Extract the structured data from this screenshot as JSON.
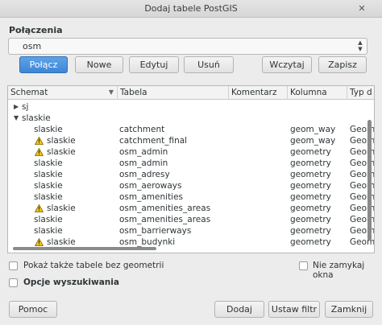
{
  "window": {
    "title": "Dodaj tabele PostGIS",
    "close_glyph": "✕"
  },
  "connections": {
    "label": "Połączenia",
    "selected": "osm",
    "buttons": {
      "connect": "Połącz",
      "new": "Nowe",
      "edit": "Edytuj",
      "delete": "Usuń",
      "load": "Wczytaj",
      "save": "Zapisz"
    }
  },
  "table": {
    "columns": [
      "Schemat",
      "Tabela",
      "Komentarz",
      "Kolumna",
      "Typ d"
    ],
    "tree": [
      {
        "label": "sj",
        "expanded": false
      },
      {
        "label": "slaskie",
        "expanded": true
      }
    ],
    "rows": [
      {
        "schema": "slaskie",
        "table": "catchment",
        "comment": "",
        "column": "geom_way",
        "type": "Geom",
        "warning": false
      },
      {
        "schema": "slaskie",
        "table": "catchment_final",
        "comment": "",
        "column": "geom_way",
        "type": "Geom",
        "warning": true
      },
      {
        "schema": "slaskie",
        "table": "osm_admin",
        "comment": "",
        "column": "geometry",
        "type": "Geom",
        "warning": true
      },
      {
        "schema": "slaskie",
        "table": "osm_admin",
        "comment": "",
        "column": "geometry",
        "type": "Geom",
        "warning": false
      },
      {
        "schema": "slaskie",
        "table": "osm_adresy",
        "comment": "",
        "column": "geometry",
        "type": "Geom",
        "warning": false
      },
      {
        "schema": "slaskie",
        "table": "osm_aeroways",
        "comment": "",
        "column": "geometry",
        "type": "Geom",
        "warning": false
      },
      {
        "schema": "slaskie",
        "table": "osm_amenities",
        "comment": "",
        "column": "geometry",
        "type": "Geom",
        "warning": false
      },
      {
        "schema": "slaskie",
        "table": "osm_amenities_areas",
        "comment": "",
        "column": "geometry",
        "type": "Geom",
        "warning": true
      },
      {
        "schema": "slaskie",
        "table": "osm_amenities_areas",
        "comment": "",
        "column": "geometry",
        "type": "Geom",
        "warning": false
      },
      {
        "schema": "slaskie",
        "table": "osm_barrierways",
        "comment": "",
        "column": "geometry",
        "type": "Geom",
        "warning": false
      },
      {
        "schema": "slaskie",
        "table": "osm_budynki",
        "comment": "",
        "column": "geometry",
        "type": "Geom",
        "warning": true
      }
    ]
  },
  "options": {
    "show_no_geometry": "Pokaż także tabele bez geometrii",
    "keep_open": "Nie zamykaj okna",
    "search_options": "Opcje wyszukiwania"
  },
  "footer": {
    "help": "Pomoc",
    "add": "Dodaj",
    "set_filter": "Ustaw filtr",
    "close": "Zamknij"
  },
  "colors": {
    "accent": "#3d86d6",
    "warning": "#f0c419"
  }
}
